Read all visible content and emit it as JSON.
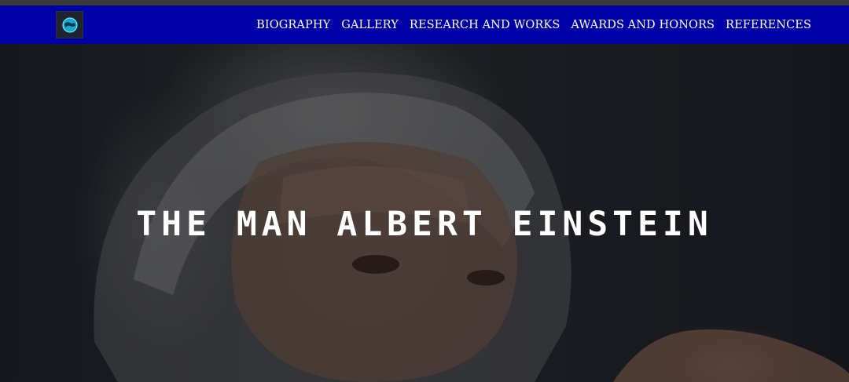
{
  "nav": {
    "logo_icon": "globe-logo-icon",
    "links": [
      {
        "label": "BIOGRAPHY"
      },
      {
        "label": "GALLERY"
      },
      {
        "label": "RESEARCH AND WORKS"
      },
      {
        "label": "AWARDS AND HONORS"
      },
      {
        "label": "REFERENCES"
      }
    ]
  },
  "hero": {
    "title": "THE MAN ALBERT EINSTEIN",
    "image": "portrait-photo"
  },
  "colors": {
    "navbar": "#0000a8",
    "top_strip": "#3a3a3a",
    "title_text": "#ffffff"
  }
}
